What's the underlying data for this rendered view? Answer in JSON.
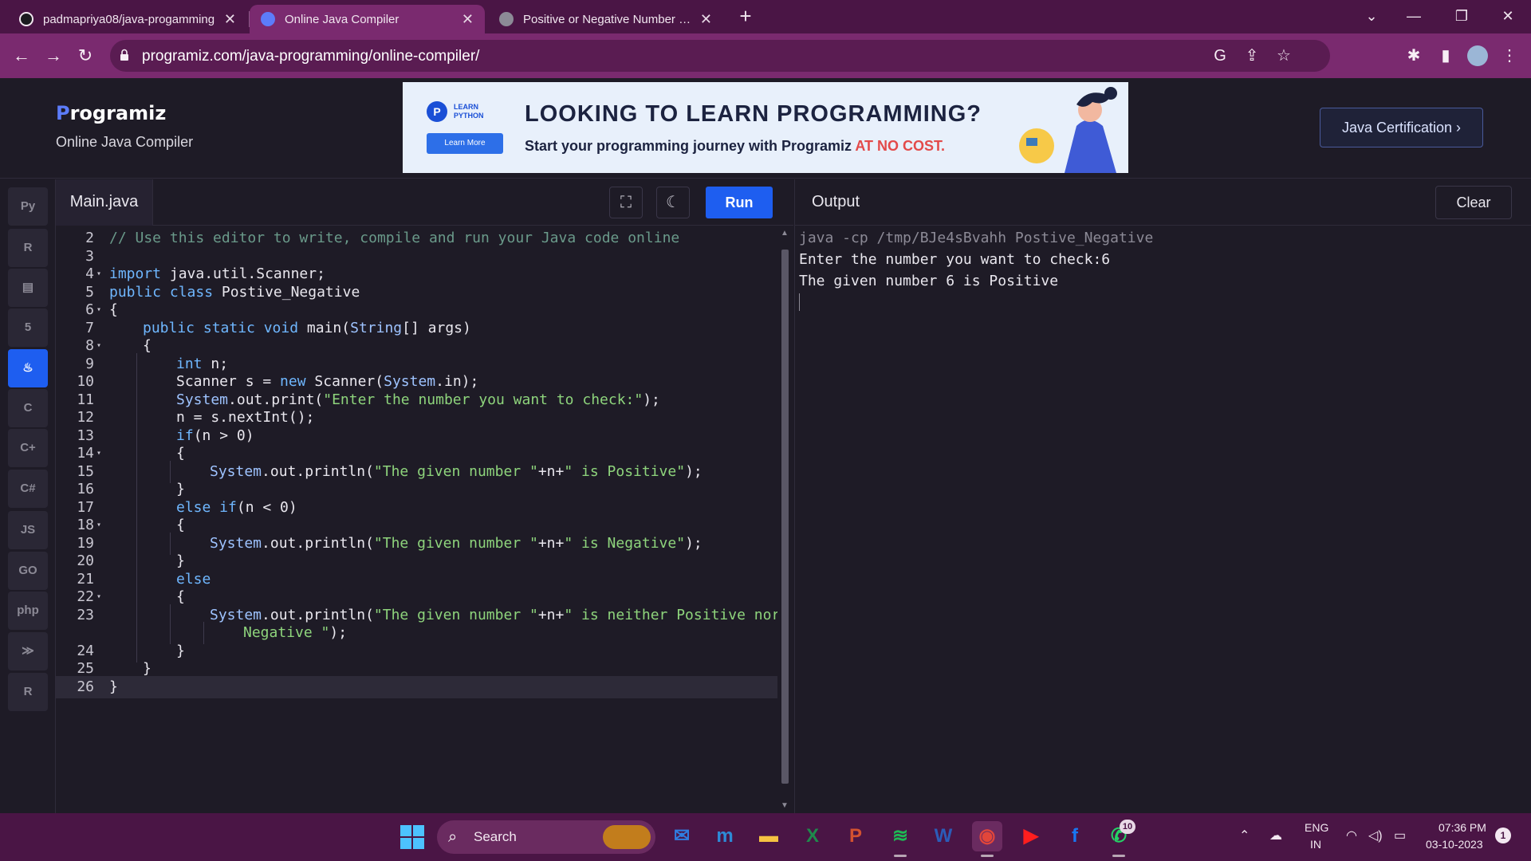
{
  "browser": {
    "tabs": [
      {
        "title": "padmapriya08/java-progamming",
        "icon_color": "#f1e6ef"
      },
      {
        "title": "Online Java Compiler",
        "icon_color": "#5c7cfa"
      },
      {
        "title": "Positive or Negative Number in J",
        "icon_color": "#d9d7df"
      }
    ],
    "new_tab_label": "+",
    "url": "programiz.com/java-programming/online-compiler/"
  },
  "site": {
    "logo_first": "P",
    "logo_rest": "rogramiz",
    "subtitle": "Online Java Compiler",
    "certification_button": "Java Certification ›"
  },
  "ad": {
    "badge_label": "LEARN PYTHON",
    "learn_more": "Learn More",
    "headline": "LOOKING TO LEARN PROGRAMMING?",
    "subline_start": "Start your programming journey with Programiz ",
    "subline_highlight": "AT NO COST."
  },
  "sidebar": {
    "languages": [
      {
        "name": "python-icon",
        "glyph": "Py",
        "active": false
      },
      {
        "name": "r-icon",
        "glyph": "R",
        "active": false
      },
      {
        "name": "sql-icon",
        "glyph": "▤",
        "active": false
      },
      {
        "name": "html5-icon",
        "glyph": "5",
        "active": false
      },
      {
        "name": "java-icon",
        "glyph": "♨",
        "active": true
      },
      {
        "name": "c-icon",
        "glyph": "C",
        "active": false
      },
      {
        "name": "cpp-icon",
        "glyph": "C+",
        "active": false
      },
      {
        "name": "csharp-icon",
        "glyph": "C#",
        "active": false
      },
      {
        "name": "js-icon",
        "glyph": "JS",
        "active": false
      },
      {
        "name": "go-icon",
        "glyph": "GO",
        "active": false
      },
      {
        "name": "php-icon",
        "glyph": "php",
        "active": false
      },
      {
        "name": "swift-icon",
        "glyph": "≫",
        "active": false
      },
      {
        "name": "rust-icon",
        "glyph": "R",
        "active": false
      }
    ]
  },
  "editor": {
    "file_name": "Main.java",
    "run_label": "Run",
    "lines": [
      {
        "n": "2",
        "fold": false,
        "indent": 0,
        "html": "<span class=\"c-comment\">// Use this editor to write, compile and run your Java code online</span>"
      },
      {
        "n": "3",
        "fold": false,
        "indent": 0,
        "html": ""
      },
      {
        "n": "4",
        "fold": true,
        "indent": 0,
        "html": "<span class=\"c-kw\">import</span> java.util.Scanner;"
      },
      {
        "n": "5",
        "fold": false,
        "indent": 0,
        "html": "<span class=\"c-kw\">public class</span> Postive_Negative"
      },
      {
        "n": "6",
        "fold": true,
        "indent": 0,
        "html": "{"
      },
      {
        "n": "7",
        "fold": false,
        "indent": 1,
        "html": "<span class=\"c-kw\">public static void</span> main(<span class=\"c-type\">String</span>[] args)"
      },
      {
        "n": "8",
        "fold": true,
        "indent": 1,
        "html": "{"
      },
      {
        "n": "9",
        "fold": false,
        "indent": 2,
        "html": "<span class=\"c-kw\">int</span> n;"
      },
      {
        "n": "10",
        "fold": false,
        "indent": 2,
        "html": "Scanner s = <span class=\"c-kw\">new</span> Scanner(<span class=\"c-type\">System</span>.in);"
      },
      {
        "n": "11",
        "fold": false,
        "indent": 2,
        "html": "<span class=\"c-type\">System</span>.out.print(<span class=\"c-str\">\"Enter the number you want to check:\"</span>);"
      },
      {
        "n": "12",
        "fold": false,
        "indent": 2,
        "html": "n = s.nextInt();"
      },
      {
        "n": "13",
        "fold": false,
        "indent": 2,
        "html": "<span class=\"c-kw\">if</span>(n > 0)"
      },
      {
        "n": "14",
        "fold": true,
        "indent": 2,
        "html": "{"
      },
      {
        "n": "15",
        "fold": false,
        "indent": 3,
        "html": "<span class=\"c-type\">System</span>.out.println(<span class=\"c-str\">\"The given number \"</span>+n+<span class=\"c-str\">\" is Positive\"</span>);"
      },
      {
        "n": "16",
        "fold": false,
        "indent": 2,
        "html": "}"
      },
      {
        "n": "17",
        "fold": false,
        "indent": 2,
        "html": "<span class=\"c-kw\">else if</span>(n < 0)"
      },
      {
        "n": "18",
        "fold": true,
        "indent": 2,
        "html": "{"
      },
      {
        "n": "19",
        "fold": false,
        "indent": 3,
        "html": "<span class=\"c-type\">System</span>.out.println(<span class=\"c-str\">\"The given number \"</span>+n+<span class=\"c-str\">\" is Negative\"</span>);"
      },
      {
        "n": "20",
        "fold": false,
        "indent": 2,
        "html": "}"
      },
      {
        "n": "21",
        "fold": false,
        "indent": 2,
        "html": "<span class=\"c-kw\">else</span>"
      },
      {
        "n": "22",
        "fold": true,
        "indent": 2,
        "html": "{"
      },
      {
        "n": "23",
        "fold": false,
        "indent": 3,
        "html": "<span class=\"c-type\">System</span>.out.println(<span class=\"c-str\">\"The given number \"</span>+n+<span class=\"c-str\">\" is neither Positive nor</span>"
      },
      {
        "n": "",
        "fold": false,
        "indent": 4,
        "html": "<span class=\"c-str\">Negative \"</span>);"
      },
      {
        "n": "24",
        "fold": false,
        "indent": 2,
        "html": "}"
      },
      {
        "n": "25",
        "fold": false,
        "indent": 1,
        "html": "}"
      },
      {
        "n": "26",
        "fold": false,
        "indent": 0,
        "html": "}",
        "current": true
      }
    ]
  },
  "output": {
    "title": "Output",
    "clear_label": "Clear",
    "lines": [
      "java -cp /tmp/BJe4sBvahh Postive_Negative",
      "Enter the number you want to check:6",
      "The given number 6 is Positive"
    ]
  },
  "taskbar": {
    "search_label": "Search",
    "apps": [
      {
        "name": "mail-icon",
        "glyph": "✉",
        "color": "#2f7de1"
      },
      {
        "name": "mylp-icon",
        "glyph": "m",
        "color": "#2d8ad6"
      },
      {
        "name": "file-explorer-icon",
        "glyph": "▬",
        "color": "#f5c242"
      },
      {
        "name": "excel-icon",
        "glyph": "X",
        "color": "#1f8a4c"
      },
      {
        "name": "powerpoint-icon",
        "glyph": "P",
        "color": "#d35230"
      },
      {
        "name": "spotify-icon",
        "glyph": "≋",
        "color": "#1db954"
      },
      {
        "name": "word-icon",
        "glyph": "W",
        "color": "#2b5cb8"
      },
      {
        "name": "chrome-icon",
        "glyph": "◉",
        "color": "#e2463a"
      },
      {
        "name": "youtube-icon",
        "glyph": "▶",
        "color": "#ff1e1e"
      },
      {
        "name": "facebook-icon",
        "glyph": "f",
        "color": "#1877f2"
      },
      {
        "name": "whatsapp-icon",
        "glyph": "✆",
        "color": "#25d366"
      }
    ],
    "whatsapp_badge": "10",
    "lang_primary": "ENG",
    "lang_secondary": "IN",
    "time": "07:36 PM",
    "date": "03-10-2023",
    "notification_count": "1"
  }
}
